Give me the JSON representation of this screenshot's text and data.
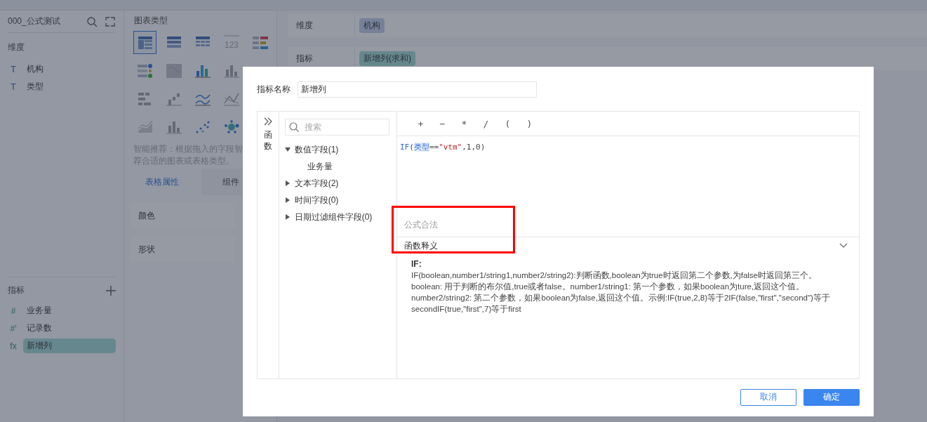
{
  "dataset": {
    "title": "000_公式测试"
  },
  "dimensions": {
    "title": "维度",
    "items": [
      {
        "icon": "T",
        "label": "机构"
      },
      {
        "icon": "T",
        "label": "类型"
      }
    ]
  },
  "metrics": {
    "title": "指标",
    "items": [
      {
        "icon": "#",
        "label": "业务量",
        "selected": false
      },
      {
        "icon": "#'",
        "label": "记录数",
        "selected": false
      },
      {
        "icon": "fx",
        "label": "新增列",
        "selected": true
      }
    ]
  },
  "chart_panel": {
    "title": "图表类型",
    "type_rows": [
      [
        {
          "kind": "table-summary",
          "selected": true
        },
        {
          "kind": "table-detail",
          "selected": false
        },
        {
          "kind": "table-cross",
          "selected": false
        },
        {
          "kind": "kpi",
          "selected": false,
          "text": "123"
        },
        {
          "kind": "colored-table",
          "selected": false
        }
      ],
      [
        {
          "kind": "status-table",
          "selected": false
        },
        {
          "kind": "map",
          "selected": false
        },
        {
          "kind": "column-colored",
          "selected": false
        },
        {
          "kind": "column",
          "selected": false
        }
      ],
      [
        {
          "kind": "bar-horizontal",
          "selected": false
        },
        {
          "kind": "step",
          "selected": false
        },
        {
          "kind": "lines",
          "selected": false
        },
        {
          "kind": "line-cross",
          "selected": false
        }
      ],
      [
        {
          "kind": "area",
          "selected": false
        },
        {
          "kind": "column",
          "selected": false
        },
        {
          "kind": "scatter",
          "selected": false
        },
        {
          "kind": "bubble",
          "selected": false
        }
      ]
    ],
    "hint_lines": [
      "智能推荐：根据拖入的字段智",
      "荐合适的图表或表格类型。"
    ],
    "tabs": [
      {
        "label": "表格属性",
        "selected": true
      },
      {
        "label": "组件",
        "selected": false
      }
    ],
    "properties": [
      "颜色",
      "形状"
    ]
  },
  "shelves": [
    {
      "label": "维度",
      "chip": "机构",
      "kind": "dimension"
    },
    {
      "label": "指标",
      "chip": "新增列(求和)",
      "kind": "metric"
    }
  ],
  "dialog": {
    "name_label": "指标名称",
    "name_value": "新增列",
    "functions_tab": "函数",
    "search": {
      "placeholder": "搜索"
    },
    "field_tree": [
      {
        "label": "数值字段(1)",
        "expanded": true,
        "children": [
          {
            "label": "业务量"
          }
        ]
      },
      {
        "label": "文本字段(2)",
        "expanded": false
      },
      {
        "label": "时间字段(0)",
        "expanded": false
      },
      {
        "label": "日期过滤组件字段(0)",
        "expanded": false
      }
    ],
    "operators": [
      "+",
      "−",
      "*",
      "/",
      "(",
      ")"
    ],
    "formula": [
      {
        "kind": "function",
        "text": "IF"
      },
      {
        "kind": "punct",
        "text": "("
      },
      {
        "kind": "field",
        "text": "类型"
      },
      {
        "kind": "operator",
        "text": "=="
      },
      {
        "kind": "string",
        "text": "\"vtm\""
      },
      {
        "kind": "punct",
        "text": ",1,0)"
      }
    ],
    "status": "公式合法",
    "explain_title": "函数释义",
    "explain_expanded": true,
    "explain_heading": "IF:",
    "explain_body": "IF(boolean,number1/string1,number2/string2):判断函数,boolean为true时返回第二个参数,为false时返回第三个。boolean: 用于判断的布尔值,true或者false。number1/string1: 第一个参数，如果boolean为ture,返回这个值。number2/string2: 第二个参数，如果boolean为false,返回这个值。示例:IF(true,2,8)等于2IF(false,\"first\",\"second\")等于secondIF(true,\"first\",7)等于first",
    "buttons": [
      {
        "label": "取消",
        "kind": "secondary"
      },
      {
        "label": "确定",
        "kind": "primary"
      }
    ]
  }
}
